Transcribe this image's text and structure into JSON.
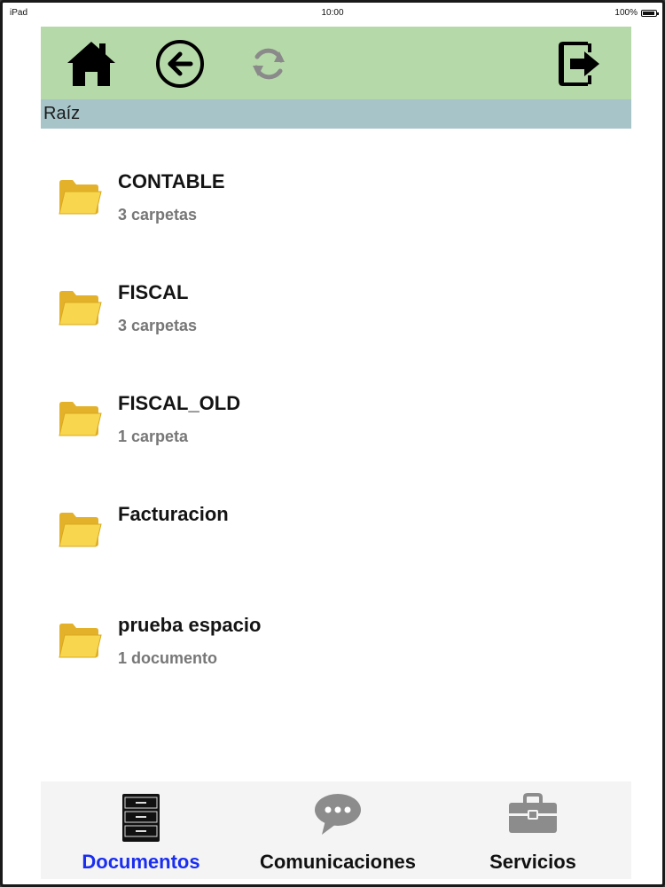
{
  "status_bar": {
    "carrier": "iPad",
    "time": "10:00",
    "battery": "100%"
  },
  "toolbar": {
    "home_icon": "home-icon",
    "back_icon": "back-arrow-circle-icon",
    "refresh_icon": "refresh-icon",
    "exit_icon": "logout-icon"
  },
  "breadcrumb": {
    "label": "Raíz"
  },
  "folders": [
    {
      "name": "CONTABLE",
      "detail": "3 carpetas"
    },
    {
      "name": "FISCAL",
      "detail": "3 carpetas"
    },
    {
      "name": "FISCAL_OLD",
      "detail": "1 carpeta"
    },
    {
      "name": "Facturacion",
      "detail": ""
    },
    {
      "name": "prueba espacio",
      "detail": "1 documento"
    }
  ],
  "tabbar": {
    "tabs": [
      {
        "label": "Documentos",
        "icon": "filing-cabinet-icon",
        "selected": true
      },
      {
        "label": "Comunicaciones",
        "icon": "chat-bubble-icon",
        "selected": false
      },
      {
        "label": "Servicios",
        "icon": "toolbox-icon",
        "selected": false
      }
    ]
  },
  "colors": {
    "toolbar_bg": "#b6d9a9",
    "breadcrumb_bg": "#a7c4c9",
    "selected_tab": "#1a2ef0",
    "folder_yellow": "#f7d04a"
  }
}
